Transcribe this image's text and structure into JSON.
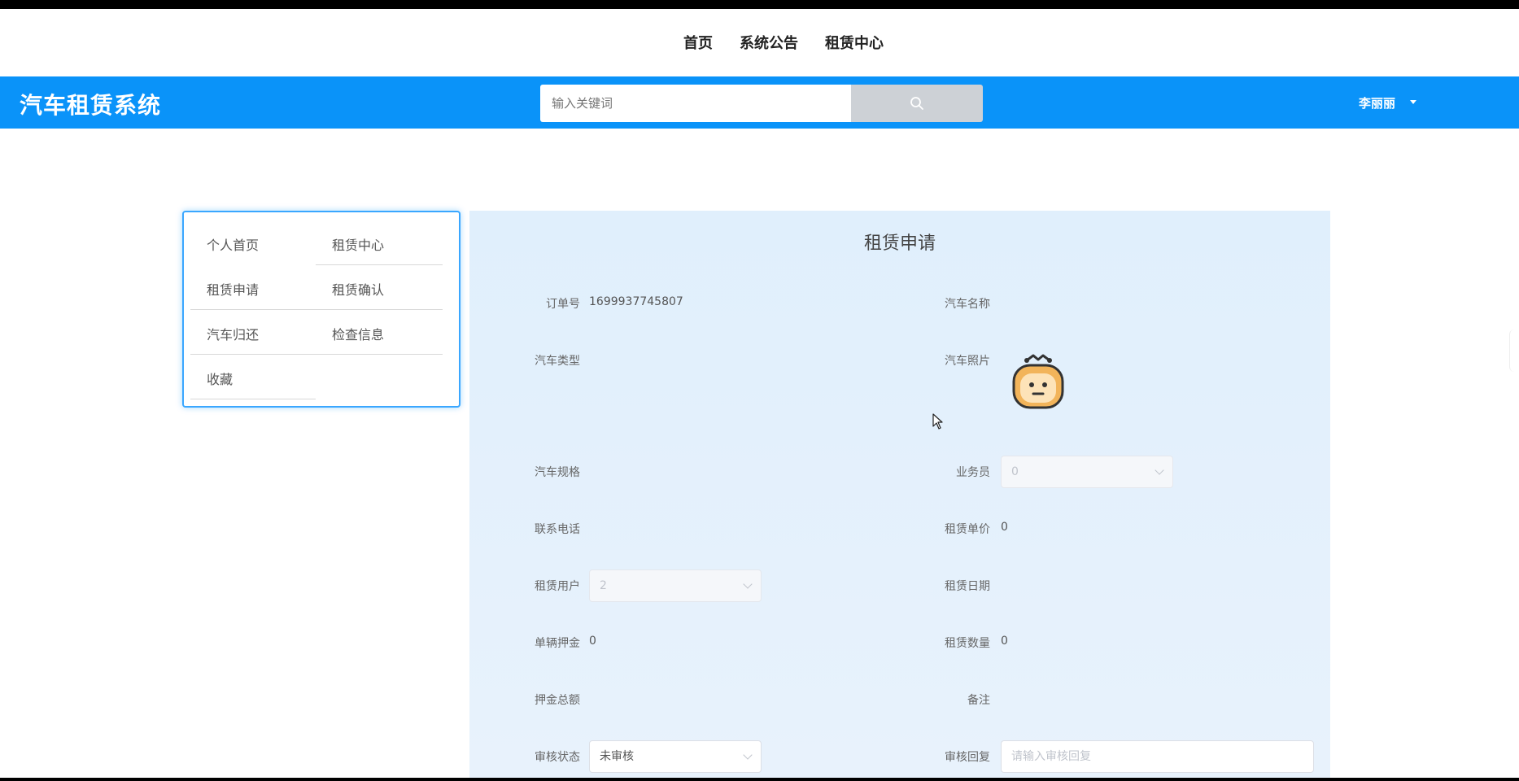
{
  "topnav": {
    "items": [
      {
        "label": "首页"
      },
      {
        "label": "系统公告"
      },
      {
        "label": "租赁中心"
      }
    ]
  },
  "header": {
    "brand": "汽车租赁系统",
    "search_placeholder": "输入关键词",
    "user_name": "李丽丽",
    "accent_color": "#0a93f9"
  },
  "sidebar": {
    "items": [
      {
        "label": "个人首页"
      },
      {
        "label": "租赁中心"
      },
      {
        "label": "租赁申请"
      },
      {
        "label": "租赁确认"
      },
      {
        "label": "汽车归还"
      },
      {
        "label": "检查信息"
      },
      {
        "label": "收藏"
      }
    ]
  },
  "form": {
    "title": "租赁申请",
    "order_no_label": "订单号",
    "order_no_value": "1699937745807",
    "car_name_label": "汽车名称",
    "car_name_value": "",
    "car_type_label": "汽车类型",
    "car_type_value": "",
    "car_photo_label": "汽车照片",
    "car_spec_label": "汽车规格",
    "car_spec_value": "",
    "salesman_label": "业务员",
    "salesman_value": "0",
    "phone_label": "联系电话",
    "phone_value": "",
    "unit_price_label": "租赁单价",
    "unit_price_value": "0",
    "rent_user_label": "租赁用户",
    "rent_user_value": "2",
    "rent_date_label": "租赁日期",
    "rent_date_value": "",
    "deposit_label": "单辆押金",
    "deposit_value": "0",
    "quantity_label": "租赁数量",
    "quantity_value": "0",
    "deposit_total_label": "押金总额",
    "deposit_total_value": "",
    "remark_label": "备注",
    "remark_value": "",
    "review_status_label": "审核状态",
    "review_status_value": "未审核",
    "review_reply_label": "审核回复",
    "review_reply_placeholder": "请输入审核回复"
  }
}
